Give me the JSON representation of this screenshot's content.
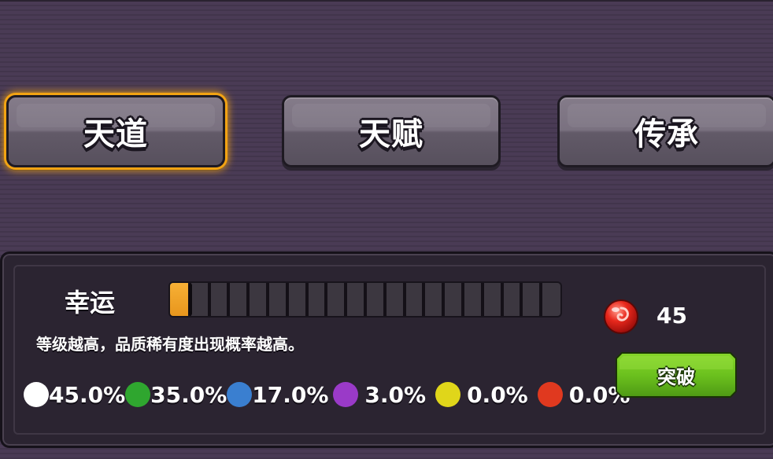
{
  "tabs": [
    {
      "label": "天道",
      "selected": true
    },
    {
      "label": "天赋",
      "selected": false
    },
    {
      "label": "传承",
      "selected": false
    }
  ],
  "luck": {
    "label": "幸运",
    "progress_fraction": 0.05,
    "segments": 20,
    "description": "等级越高，品质稀有度出现概率越高。"
  },
  "quality_rates": [
    {
      "color": "#ffffff",
      "value": "45.0%"
    },
    {
      "color": "#2fa62f",
      "value": "35.0%"
    },
    {
      "color": "#3a7fd0",
      "value": "17.0%"
    },
    {
      "color": "#9a3ac8",
      "value": "3.0%"
    },
    {
      "color": "#e0d61a",
      "value": "0.0%"
    },
    {
      "color": "#e0391f",
      "value": "0.0%"
    }
  ],
  "currency": {
    "icon": "red-gem-icon",
    "count": "45"
  },
  "breakthrough_button": {
    "label": "突破"
  },
  "colors": {
    "accent_selected": "#f2a313",
    "progress_fill": "#f0a32a",
    "button_green": "#6cc11e"
  }
}
